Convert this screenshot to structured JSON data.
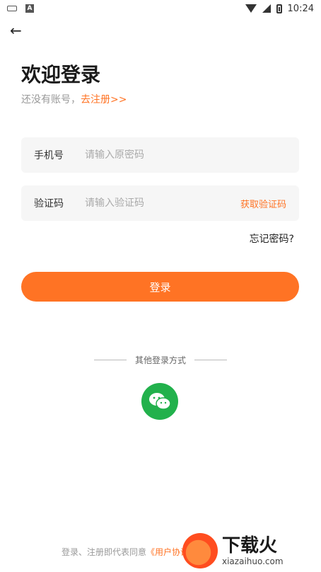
{
  "status": {
    "time": "10:24"
  },
  "page": {
    "title": "欢迎登录",
    "subtitle": {
      "text": "还没有账号，",
      "link": "去注册>>"
    }
  },
  "form": {
    "phone": {
      "label": "手机号",
      "placeholder": "请输入原密码"
    },
    "code": {
      "label": "验证码",
      "placeholder": "请输入验证码",
      "action": "获取验证码"
    },
    "forgot": "忘记密码?"
  },
  "login_button": "登录",
  "other_login": {
    "label": "其他登录方式",
    "method": "wechat-icon"
  },
  "agreement": {
    "text": "登录、注册即代表同意",
    "link": "《用户协议"
  },
  "watermark": {
    "title": "下载火",
    "domain": "xiazaihuo.com"
  },
  "colors": {
    "accent": "#ff7324",
    "wechat": "#22b14c",
    "field_bg": "#f6f6f6"
  }
}
